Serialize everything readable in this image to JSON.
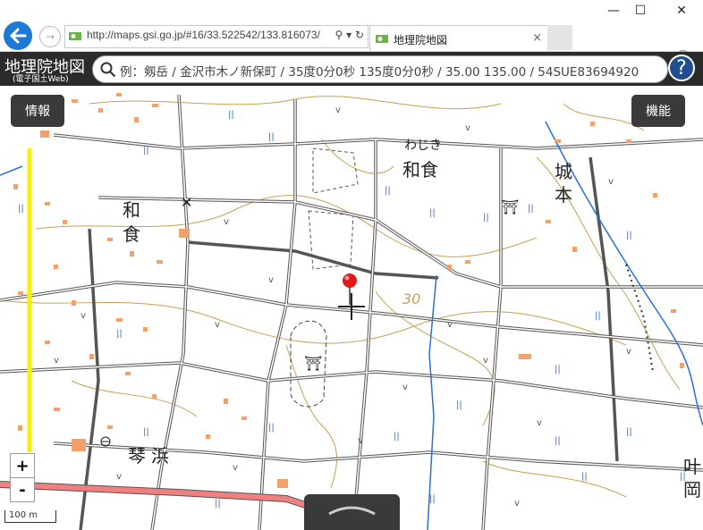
{
  "browser": {
    "url": "http://maps.gsi.go.jp/#16/33.522542/133.816073/",
    "tab_title": "地理院地図",
    "tab_close": "×",
    "address_tools": "⚲ ▾ ↻",
    "window": {
      "minimize": "—",
      "maximize": "☐",
      "close": "✕"
    },
    "forward": "→",
    "right_icons": "⌂☆⚙☺"
  },
  "header": {
    "logo": "地理院地図",
    "logo_sub": "(電子国土Web)",
    "search_placeholder": "例：剱岳 / 金沢市木ノ新保町 / 35度0分0秒 135度0分0秒 / 35.00 135.00 / 54SUE83694920",
    "help": "?"
  },
  "map": {
    "info_button": "情報",
    "function_button": "機能",
    "zoom_in": "+",
    "zoom_out": "-",
    "scale": "100 m",
    "contour_label": "30",
    "labels": {
      "washiki": "わじき",
      "wajiki_kanji": "和食",
      "wa": "和",
      "shoku": "食",
      "jo": "城",
      "hon": "本",
      "koto": "琴",
      "hama": "浜",
      "kano": "叶",
      "oka": "岡"
    },
    "colors": {
      "road_main": "#f08080",
      "river": "#2a6ee0",
      "contour": "#c8a050",
      "building": "#f4a06a",
      "boundary": "#ffff00"
    }
  }
}
